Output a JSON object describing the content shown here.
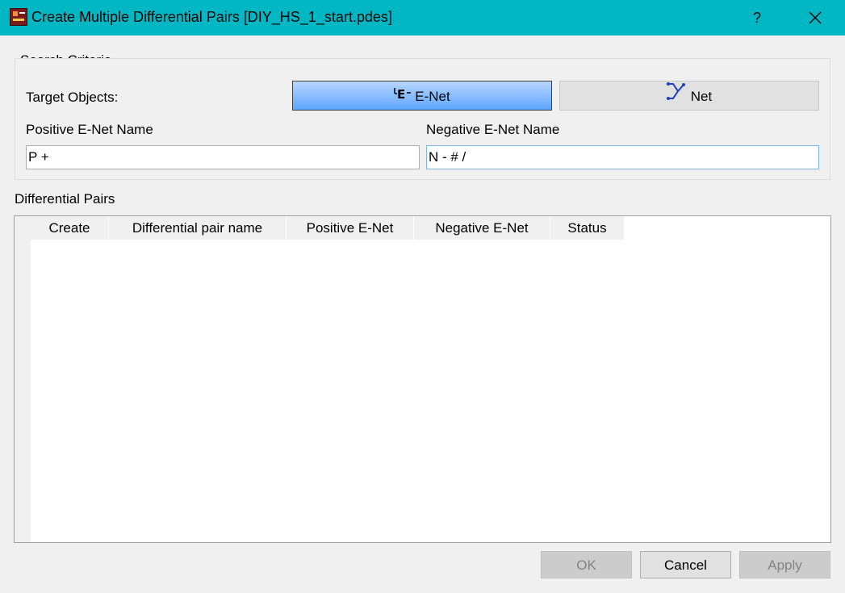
{
  "window": {
    "title": "Create Multiple Differential Pairs [DIY_HS_1_start.pdes]",
    "help_label": "?",
    "accent": "#00b7c3"
  },
  "search_criteria": {
    "group_label": "Search Criteria",
    "target_objects_label": "Target Objects:",
    "target_options": [
      {
        "label": "E-Net",
        "icon": "enet-icon",
        "selected": true
      },
      {
        "label": "Net",
        "icon": "net-icon",
        "selected": false
      }
    ],
    "positive_label": "Positive E-Net Name",
    "positive_value": "P +",
    "negative_label": "Negative E-Net Name",
    "negative_value": "N - # /"
  },
  "differential_pairs": {
    "group_label": "Differential Pairs",
    "columns": [
      "Create",
      "Differential pair name",
      "Positive E-Net",
      "Negative E-Net",
      "Status"
    ],
    "rows": []
  },
  "footer": {
    "ok_label": "OK",
    "cancel_label": "Cancel",
    "apply_label": "Apply"
  },
  "icons": {
    "enet_glyph": "E"
  }
}
